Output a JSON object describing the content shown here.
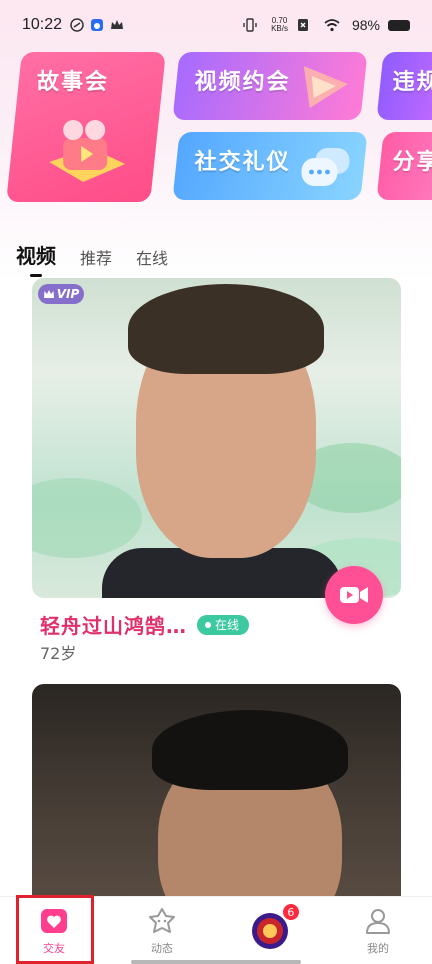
{
  "status_bar": {
    "time": "10:22",
    "net_speed_value": "0.70",
    "net_speed_unit": "KB/s",
    "battery": "98%"
  },
  "banners": {
    "story": "故事会",
    "video_date": "视频约会",
    "social_etiquette": "社交礼仪",
    "extra1_partial": "违规",
    "extra2_partial": "分享"
  },
  "tabs": [
    "视频",
    "推荐",
    "在线"
  ],
  "feed": {
    "card1": {
      "vip_label": "VIP",
      "name": "轻舟过山鸿鹄…",
      "status": "在线",
      "age": "72岁"
    }
  },
  "bottom_nav": {
    "items": [
      {
        "label": "交友"
      },
      {
        "label": "动态"
      },
      {
        "label": ""
      },
      {
        "label": "我的"
      }
    ],
    "badge": "6"
  },
  "colors": {
    "accent": "#ff3e8e",
    "name_color": "#e0306a",
    "online": "#3cc9a0",
    "highlight_box": "#e0212e"
  }
}
